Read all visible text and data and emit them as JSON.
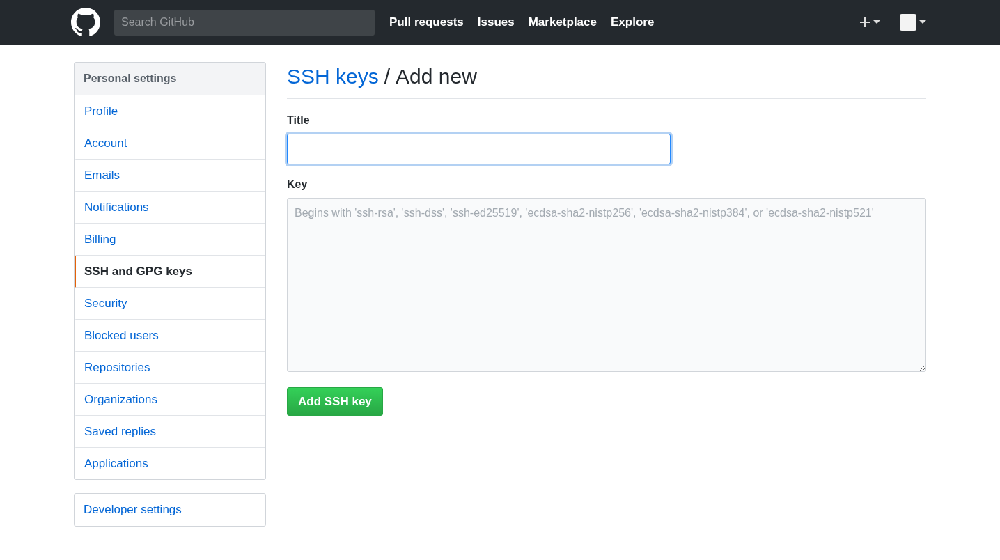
{
  "header": {
    "search": {
      "placeholder": "Search GitHub"
    },
    "nav": [
      "Pull requests",
      "Issues",
      "Marketplace",
      "Explore"
    ]
  },
  "sidebar": {
    "heading": "Personal settings",
    "items": [
      {
        "label": "Profile",
        "selected": false
      },
      {
        "label": "Account",
        "selected": false
      },
      {
        "label": "Emails",
        "selected": false
      },
      {
        "label": "Notifications",
        "selected": false
      },
      {
        "label": "Billing",
        "selected": false
      },
      {
        "label": "SSH and GPG keys",
        "selected": true
      },
      {
        "label": "Security",
        "selected": false
      },
      {
        "label": "Blocked users",
        "selected": false
      },
      {
        "label": "Repositories",
        "selected": false
      },
      {
        "label": "Organizations",
        "selected": false
      },
      {
        "label": "Saved replies",
        "selected": false
      },
      {
        "label": "Applications",
        "selected": false
      }
    ],
    "developer": "Developer settings"
  },
  "page": {
    "breadcrumb_link": "SSH keys",
    "separator": "/",
    "title": "Add new"
  },
  "form": {
    "title_label": "Title",
    "title_focused": true,
    "key_label": "Key",
    "key_placeholder": "Begins with 'ssh-rsa', 'ssh-dss', 'ssh-ed25519', 'ecdsa-sha2-nistp256', 'ecdsa-sha2-nistp384', or 'ecdsa-sha2-nistp521'",
    "submit": "Add SSH key"
  }
}
